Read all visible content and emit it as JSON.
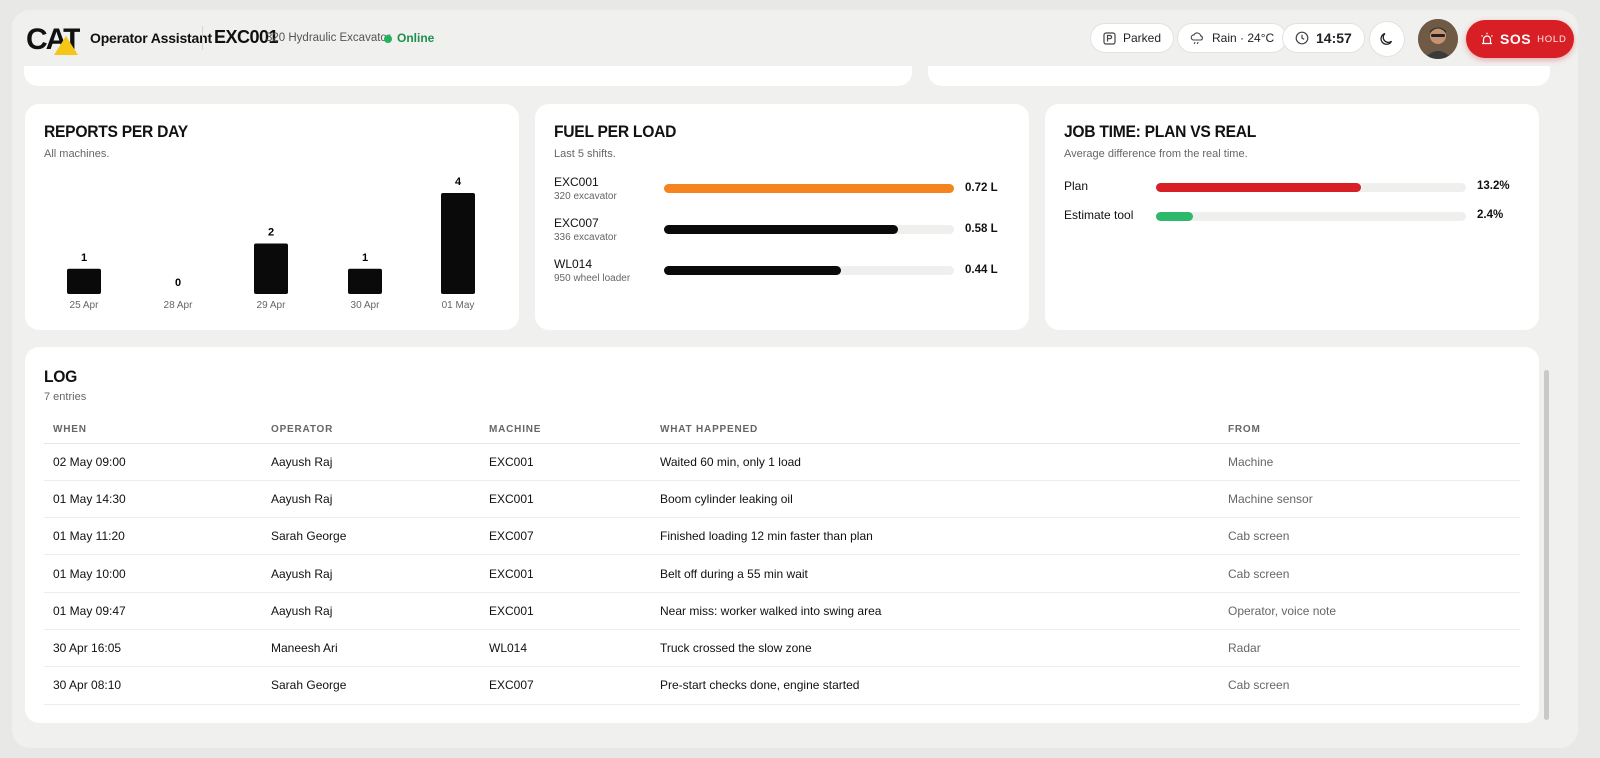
{
  "header": {
    "logo_text": "CAT",
    "app_title": "Operator Assistant",
    "machine_id": "EXC001",
    "machine_model": "320 Hydraulic Excavator",
    "status": "Online",
    "parked_label": "Parked",
    "weather_label": "Rain · 24°C",
    "time": "14:57",
    "sos_label": "SOS",
    "hold_label": "HOLD"
  },
  "reports": {
    "title": "REPORTS PER DAY",
    "subtitle": "All machines."
  },
  "chart_data": {
    "type": "bar",
    "title": "REPORTS PER DAY",
    "categories": [
      "25 Apr",
      "28 Apr",
      "29 Apr",
      "30 Apr",
      "01 May"
    ],
    "values": [
      1,
      0,
      2,
      1,
      4
    ],
    "xlabel": "",
    "ylabel": "",
    "ylim": [
      0,
      4
    ],
    "grid": false
  },
  "fuel": {
    "title": "FUEL PER LOAD",
    "subtitle": "Last 5 shifts.",
    "rows": [
      {
        "name": "EXC001",
        "type": "320 excavator",
        "value": "0.72 L",
        "fraction": 1.0,
        "color": "#f5841f"
      },
      {
        "name": "EXC007",
        "type": "336 excavator",
        "value": "0.58 L",
        "fraction": 0.806,
        "color": "#0a0a0a"
      },
      {
        "name": "WL014",
        "type": "950 wheel loader",
        "value": "0.44 L",
        "fraction": 0.611,
        "color": "#0a0a0a"
      }
    ]
  },
  "job": {
    "title": "JOB TIME: PLAN VS REAL",
    "subtitle": "Average difference from the real time.",
    "rows": [
      {
        "label": "Plan",
        "value": "13.2%",
        "fraction": 0.66,
        "color": "#d81f26"
      },
      {
        "label": "Estimate tool",
        "value": "2.4%",
        "fraction": 0.12,
        "color": "#2db86a"
      }
    ]
  },
  "log": {
    "title": "LOG",
    "subtitle": "7 entries",
    "columns": [
      "WHEN",
      "OPERATOR",
      "MACHINE",
      "WHAT HAPPENED",
      "FROM"
    ],
    "rows": [
      [
        "02 May 09:00",
        "Aayush Raj",
        "EXC001",
        "Waited 60 min, only 1 load",
        "Machine"
      ],
      [
        "01 May 14:30",
        "Aayush Raj",
        "EXC001",
        "Boom cylinder leaking oil",
        "Machine sensor"
      ],
      [
        "01 May 11:20",
        "Sarah George",
        "EXC007",
        "Finished loading 12 min faster than plan",
        "Cab screen"
      ],
      [
        "01 May 10:00",
        "Aayush Raj",
        "EXC001",
        "Belt off during a 55 min wait",
        "Cab screen"
      ],
      [
        "01 May 09:47",
        "Aayush Raj",
        "EXC001",
        "Near miss: worker walked into swing area",
        "Operator, voice note"
      ],
      [
        "30 Apr 16:05",
        "Maneesh Ari",
        "WL014",
        "Truck crossed the slow zone",
        "Radar"
      ],
      [
        "30 Apr 08:10",
        "Sarah George",
        "EXC007",
        "Pre-start checks done, engine started",
        "Cab screen"
      ]
    ]
  }
}
